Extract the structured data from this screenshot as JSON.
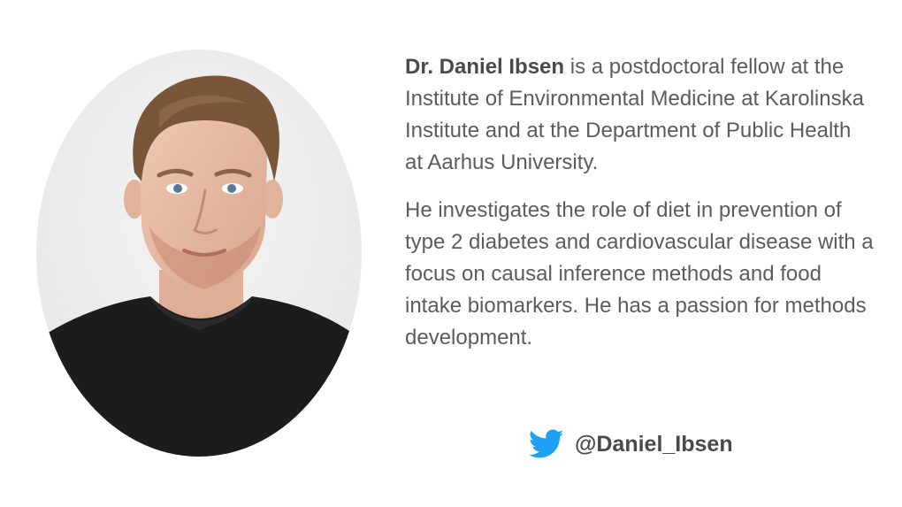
{
  "person": {
    "name": "Dr. Daniel Ibsen",
    "bio_intro_rest": " is a postdoctoral fellow at the Institute of Environmental Medicine at Karolinska Institute and at the Department of Public Health at Aarhus University.",
    "bio_research": "He investigates the role of diet in prevention of type 2 diabetes and cardiovascular disease with a focus on causal inference methods and food intake biomarkers. He has a passion for methods development.",
    "photo_alt": "portrait-photo"
  },
  "social": {
    "icon": "twitter-bird-icon",
    "handle": "@Daniel_Ibsen",
    "brand_color": "#1da1f2"
  },
  "colors": {
    "text": "#5c5c5c",
    "name_text": "#4a4a4a",
    "background": "#ffffff"
  }
}
